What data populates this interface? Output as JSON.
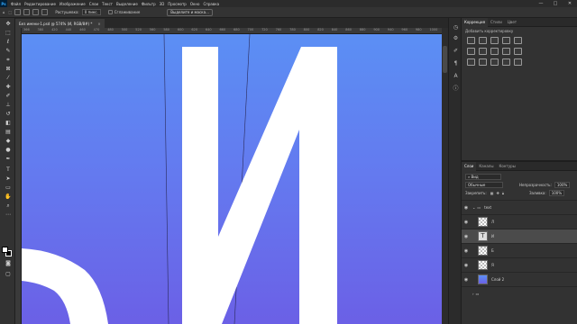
{
  "menubar": {
    "app_badge": "Ps",
    "items": [
      "Файл",
      "Редактирование",
      "Изображение",
      "Слои",
      "Текст",
      "Выделение",
      "Фильтр",
      "3D",
      "Просмотр",
      "Окно",
      "Справка"
    ],
    "window_buttons": [
      "—",
      "□",
      "✕"
    ]
  },
  "options": {
    "feather_label": "Растушевка:",
    "feather_value": "0 пикс.",
    "antialias_label": "Сглаживание",
    "select_mask_button": "Выделите и маска..."
  },
  "document": {
    "tab_title": "Без имени-1.psd @ 574% (И, RGB/8#) *",
    "tab_close": "×"
  },
  "ruler": {
    "ticks": [
      "366",
      "380",
      "420",
      "440",
      "460",
      "470",
      "480",
      "500",
      "520",
      "560",
      "580",
      "600",
      "620",
      "640",
      "660",
      "680",
      "700",
      "720",
      "760",
      "780",
      "800",
      "820",
      "840",
      "860",
      "880",
      "900",
      "940",
      "960",
      "980",
      "1000"
    ]
  },
  "canvas": {
    "letter_main": "И",
    "letter_partial": "Э",
    "gradient_colors": [
      "#5b8ff4",
      "#6479ef",
      "#6b60e6"
    ]
  },
  "adjustments_panel": {
    "tabs": [
      "Коррекция",
      "Стили",
      "Цвет"
    ],
    "add_label": "Добавить корректировку"
  },
  "layers_panel": {
    "tabs": [
      "Слои",
      "Каналы",
      "Контуры"
    ],
    "filter_label": "Вид",
    "blend_mode": "Обычные",
    "opacity_label": "Непрозрачность:",
    "opacity_value": "100%",
    "lock_label": "Закрепить:",
    "fill_label": "Заливка:",
    "fill_value": "100%",
    "layers": [
      {
        "name": "text",
        "kind": "group"
      },
      {
        "name": "Л",
        "kind": "raster"
      },
      {
        "name": "И",
        "kind": "text"
      },
      {
        "name": "Б",
        "kind": "raster"
      },
      {
        "name": "Я",
        "kind": "raster"
      },
      {
        "name": "Слой 2",
        "kind": "gradient"
      },
      {
        "name": "",
        "kind": "group"
      }
    ]
  }
}
